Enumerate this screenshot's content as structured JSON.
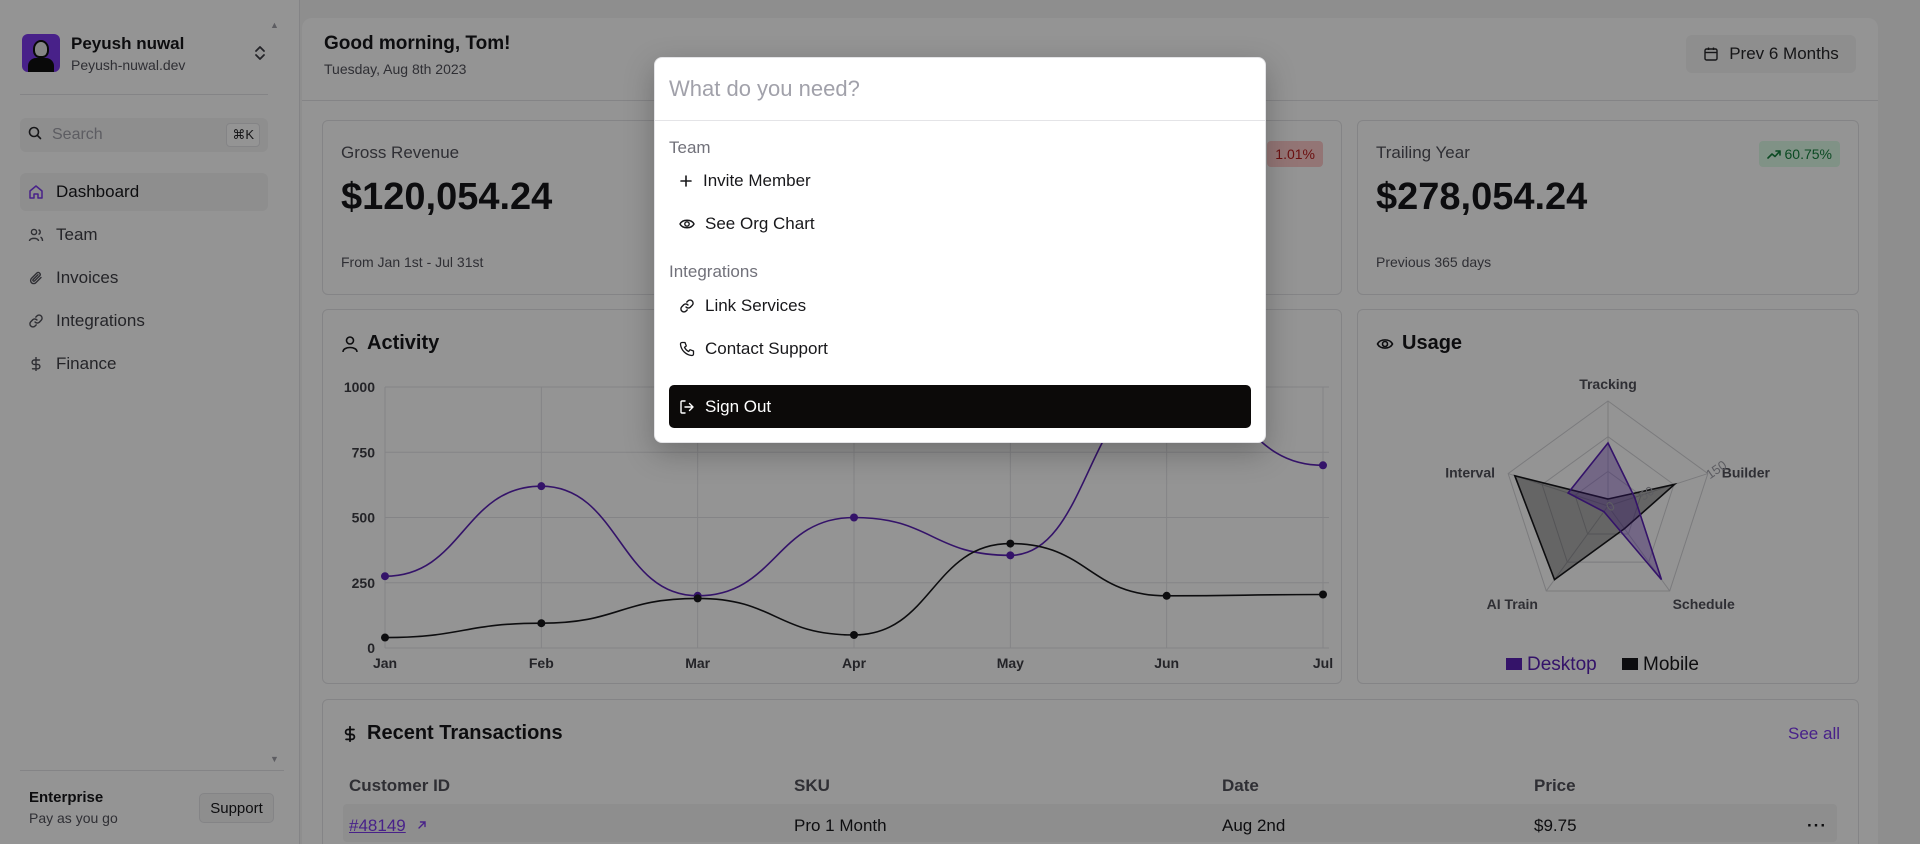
{
  "sidebar": {
    "org_name": "Peyush nuwal",
    "org_domain": "Peyush-nuwal.dev",
    "search_placeholder": "Search",
    "search_shortcut": "⌘K",
    "nav": [
      {
        "label": "Dashboard",
        "icon": "home-icon",
        "active": true
      },
      {
        "label": "Team",
        "icon": "users-icon"
      },
      {
        "label": "Invoices",
        "icon": "paperclip-icon"
      },
      {
        "label": "Integrations",
        "icon": "link-icon"
      },
      {
        "label": "Finance",
        "icon": "dollar-icon"
      }
    ],
    "plan_name": "Enterprise",
    "plan_sub": "Pay as you go",
    "support_label": "Support"
  },
  "header": {
    "greeting": "Good morning, Tom!",
    "date": "Tuesday, Aug 8th 2023",
    "range_label": "Prev 6 Months"
  },
  "cards": {
    "gross": {
      "label": "Gross Revenue",
      "value": "$120,054.24",
      "sub": "From Jan 1st - Jul 31st"
    },
    "middle": {
      "badge": "1.01%"
    },
    "trailing": {
      "label": "Trailing Year",
      "value": "$278,054.24",
      "sub": "Previous 365 days",
      "badge": "60.75%"
    }
  },
  "activity": {
    "title": "Activity"
  },
  "usage": {
    "title": "Usage"
  },
  "chart_data": [
    {
      "type": "line",
      "categories": [
        "Jan",
        "Feb",
        "Mar",
        "Apr",
        "May",
        "Jun",
        "Jul"
      ],
      "y_ticks": [
        "1000",
        "750",
        "500",
        "250",
        "0"
      ],
      "ylim": [
        0,
        1000
      ],
      "grid": true,
      "series": [
        {
          "color": "#5b21b6",
          "values": [
            275,
            620,
            200,
            500,
            355,
            1000,
            700
          ]
        },
        {
          "color": "#18181b",
          "values": [
            40,
            95,
            190,
            50,
            400,
            200,
            205
          ]
        }
      ]
    },
    {
      "type": "radar",
      "axes": [
        "Tracking",
        "Builder",
        "Schedule",
        "AI Train",
        "Interval"
      ],
      "ticks": [
        "0",
        "50",
        "150"
      ],
      "rmax": 150,
      "legend": "bottom",
      "series": [
        {
          "name": "Desktop",
          "color": "#5b21b6",
          "values": [
            90,
            40,
            130,
            10,
            60
          ]
        },
        {
          "name": "Mobile",
          "color": "#18181b",
          "values": [
            10,
            100,
            40,
            130,
            140
          ]
        }
      ]
    }
  ],
  "transactions": {
    "title": "Recent Transactions",
    "see_all": "See all",
    "columns": [
      "Customer ID",
      "SKU",
      "Date",
      "Price"
    ],
    "rows": [
      {
        "id": "#48149",
        "sku": "Pro 1 Month",
        "date": "Aug 2nd",
        "price": "$9.75"
      }
    ]
  },
  "palette": {
    "placeholder": "What do you need?",
    "groups": [
      {
        "label": "Team",
        "items": [
          {
            "label": "Invite Member",
            "icon": "plus-icon"
          },
          {
            "label": "See Org Chart",
            "icon": "eye-icon"
          }
        ]
      },
      {
        "label": "Integrations",
        "items": [
          {
            "label": "Link Services",
            "icon": "link-icon"
          },
          {
            "label": "Contact Support",
            "icon": "phone-icon"
          }
        ]
      }
    ],
    "selected": {
      "label": "Sign Out",
      "icon": "logout-icon"
    }
  }
}
